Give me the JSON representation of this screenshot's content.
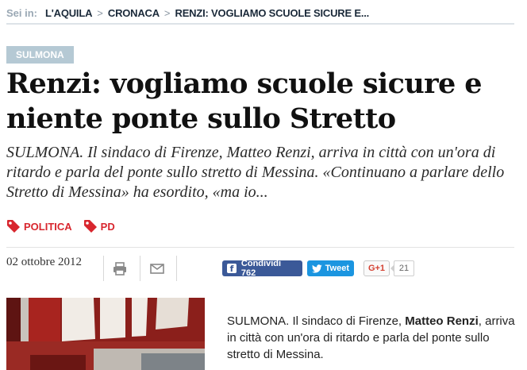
{
  "breadcrumb": {
    "prefix": "Sei in:",
    "items": [
      "L'AQUILA",
      "CRONACA",
      "RENZI: VOGLIAMO SCUOLE SICURE E..."
    ],
    "separator": ">"
  },
  "article": {
    "section": "SULMONA",
    "title": "Renzi: vogliamo scuole sicure e niente ponte sullo Stretto",
    "summary": "SULMONA. Il sindaco di Firenze, Matteo Renzi, arriva in città con un'ora di ritardo e parla del ponte sullo stretto di Messina. «Continuano a parlare dello Stretto di Messina» ha esordito, «ma io...",
    "tags": [
      "POLITICA",
      "PD"
    ],
    "date": "02 ottobre 2012",
    "body": {
      "before": "SULMONA. Il sindaco di Firenze, ",
      "bold": "Matteo Renzi",
      "after": ", arriva in città con un'ora di ritardo e parla del ponte sullo stretto di Messina."
    }
  },
  "share": {
    "facebook_label": "Condividi 762",
    "twitter_label": "Tweet",
    "gplus_label": "G+1",
    "gplus_count": "21"
  },
  "colors": {
    "tag_red": "#d8262e",
    "facebook": "#3b5998",
    "twitter": "#1b95e0",
    "section_bg": "#b5c9d4"
  },
  "icons": {
    "print": "print-icon",
    "email": "mail-icon",
    "tag": "tag-icon"
  }
}
